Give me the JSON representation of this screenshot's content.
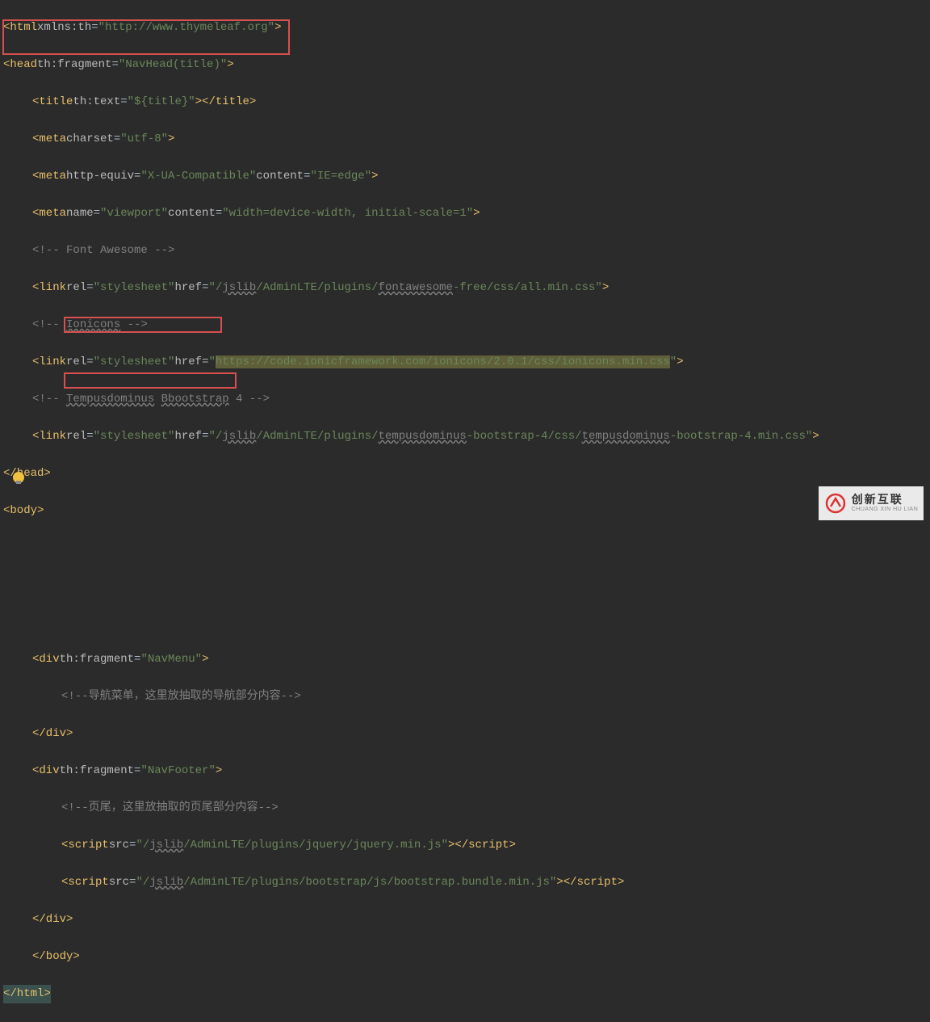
{
  "code": {
    "l1_tag": "html",
    "l1_attr": "xmlns:th",
    "l1_val": "\"http://www.thymeleaf.org\"",
    "l2_tag": "head",
    "l2_attr": "th:fragment",
    "l2_val": "\"NavHead(title)\"",
    "l3_tag": "title",
    "l3_attr": "th:text",
    "l3_val": "\"${title}\"",
    "l3_close": "title",
    "l4_tag": "meta",
    "l4_attr": "charset",
    "l4_val": "\"utf-8\"",
    "l5_tag": "meta",
    "l5_a1": "http-equiv",
    "l5_v1": "\"X-UA-Compatible\"",
    "l5_a2": "content",
    "l5_v2": "\"IE=edge\"",
    "l6_tag": "meta",
    "l6_a1": "name",
    "l6_v1": "\"viewport\"",
    "l6_a2": "content",
    "l6_v2": "\"width=device-width, initial-scale=1\"",
    "l7_comment": "<!-- Font Awesome -->",
    "l8_tag": "link",
    "l8_a1": "rel",
    "l8_v1": "\"stylesheet\"",
    "l8_a2": "href",
    "l8_v2a": "\"/",
    "l8_v2b": "jslib",
    "l8_v2c": "/AdminLTE/plugins/",
    "l8_v2d": "fontawesome",
    "l8_v2e": "-free/css/all.min.css\"",
    "l9_comment_a": "<!-- ",
    "l9_comment_b": "Ionicons",
    "l9_comment_c": " -->",
    "l10_tag": "link",
    "l10_a1": "rel",
    "l10_v1": "\"stylesheet\"",
    "l10_a2": "href",
    "l10_v2a": "\"",
    "l10_v2b": "https://code.ionicframework.com/ionicons/2.0.1/css/ionicons.min.css",
    "l10_v2c": "\"",
    "l11_comment_a": "<!-- ",
    "l11_comment_b": "Tempusdominus",
    "l11_comment_c": " ",
    "l11_comment_d": "Bbootstrap",
    "l11_comment_e": " 4 -->",
    "l12_tag": "link",
    "l12_a1": "rel",
    "l12_v1": "\"stylesheet\"",
    "l12_a2": "href",
    "l12_v2a": "\"/",
    "l12_v2b": "jslib",
    "l12_v2c": "/AdminLTE/plugins/",
    "l12_v2d": "tempusdominus",
    "l12_v2e": "-bootstrap-4/css/",
    "l12_v2f": "tempusdominus",
    "l12_v2g": "-bootstrap-4.min.css\"",
    "l13_tag": "/head",
    "l14_tag": "body",
    "l18_tag": "div",
    "l18_attr": "th:fragment",
    "l18_val": "\"NavMenu\"",
    "l19_comment": "<!--导航菜单，这里放抽取的导航部分内容-->",
    "l20_tag": "/div",
    "l21_tag": "div",
    "l21_attr": "th:fragment",
    "l21_val": "\"NavFooter\"",
    "l22_comment": "<!--页尾，这里放抽取的页尾部分内容-->",
    "l23_tag": "script",
    "l23_a1": "src",
    "l23_v1a": "\"/",
    "l23_v1b": "jslib",
    "l23_v1c": "/AdminLTE/plugins/jquery/jquery.min.js\"",
    "l23_close": "script",
    "l24_tag": "script",
    "l24_a1": "src",
    "l24_v1a": "\"/",
    "l24_v1b": "jslib",
    "l24_v1c": "/AdminLTE/plugins/bootstrap/js/bootstrap.bundle.min.js\"",
    "l24_close": "script",
    "l25_tag": "/div",
    "l26_tag": "/body",
    "l27_tag": "/html"
  },
  "logo": {
    "cn": "创新互联",
    "en": "CHUANG XIN HU LIAN"
  }
}
